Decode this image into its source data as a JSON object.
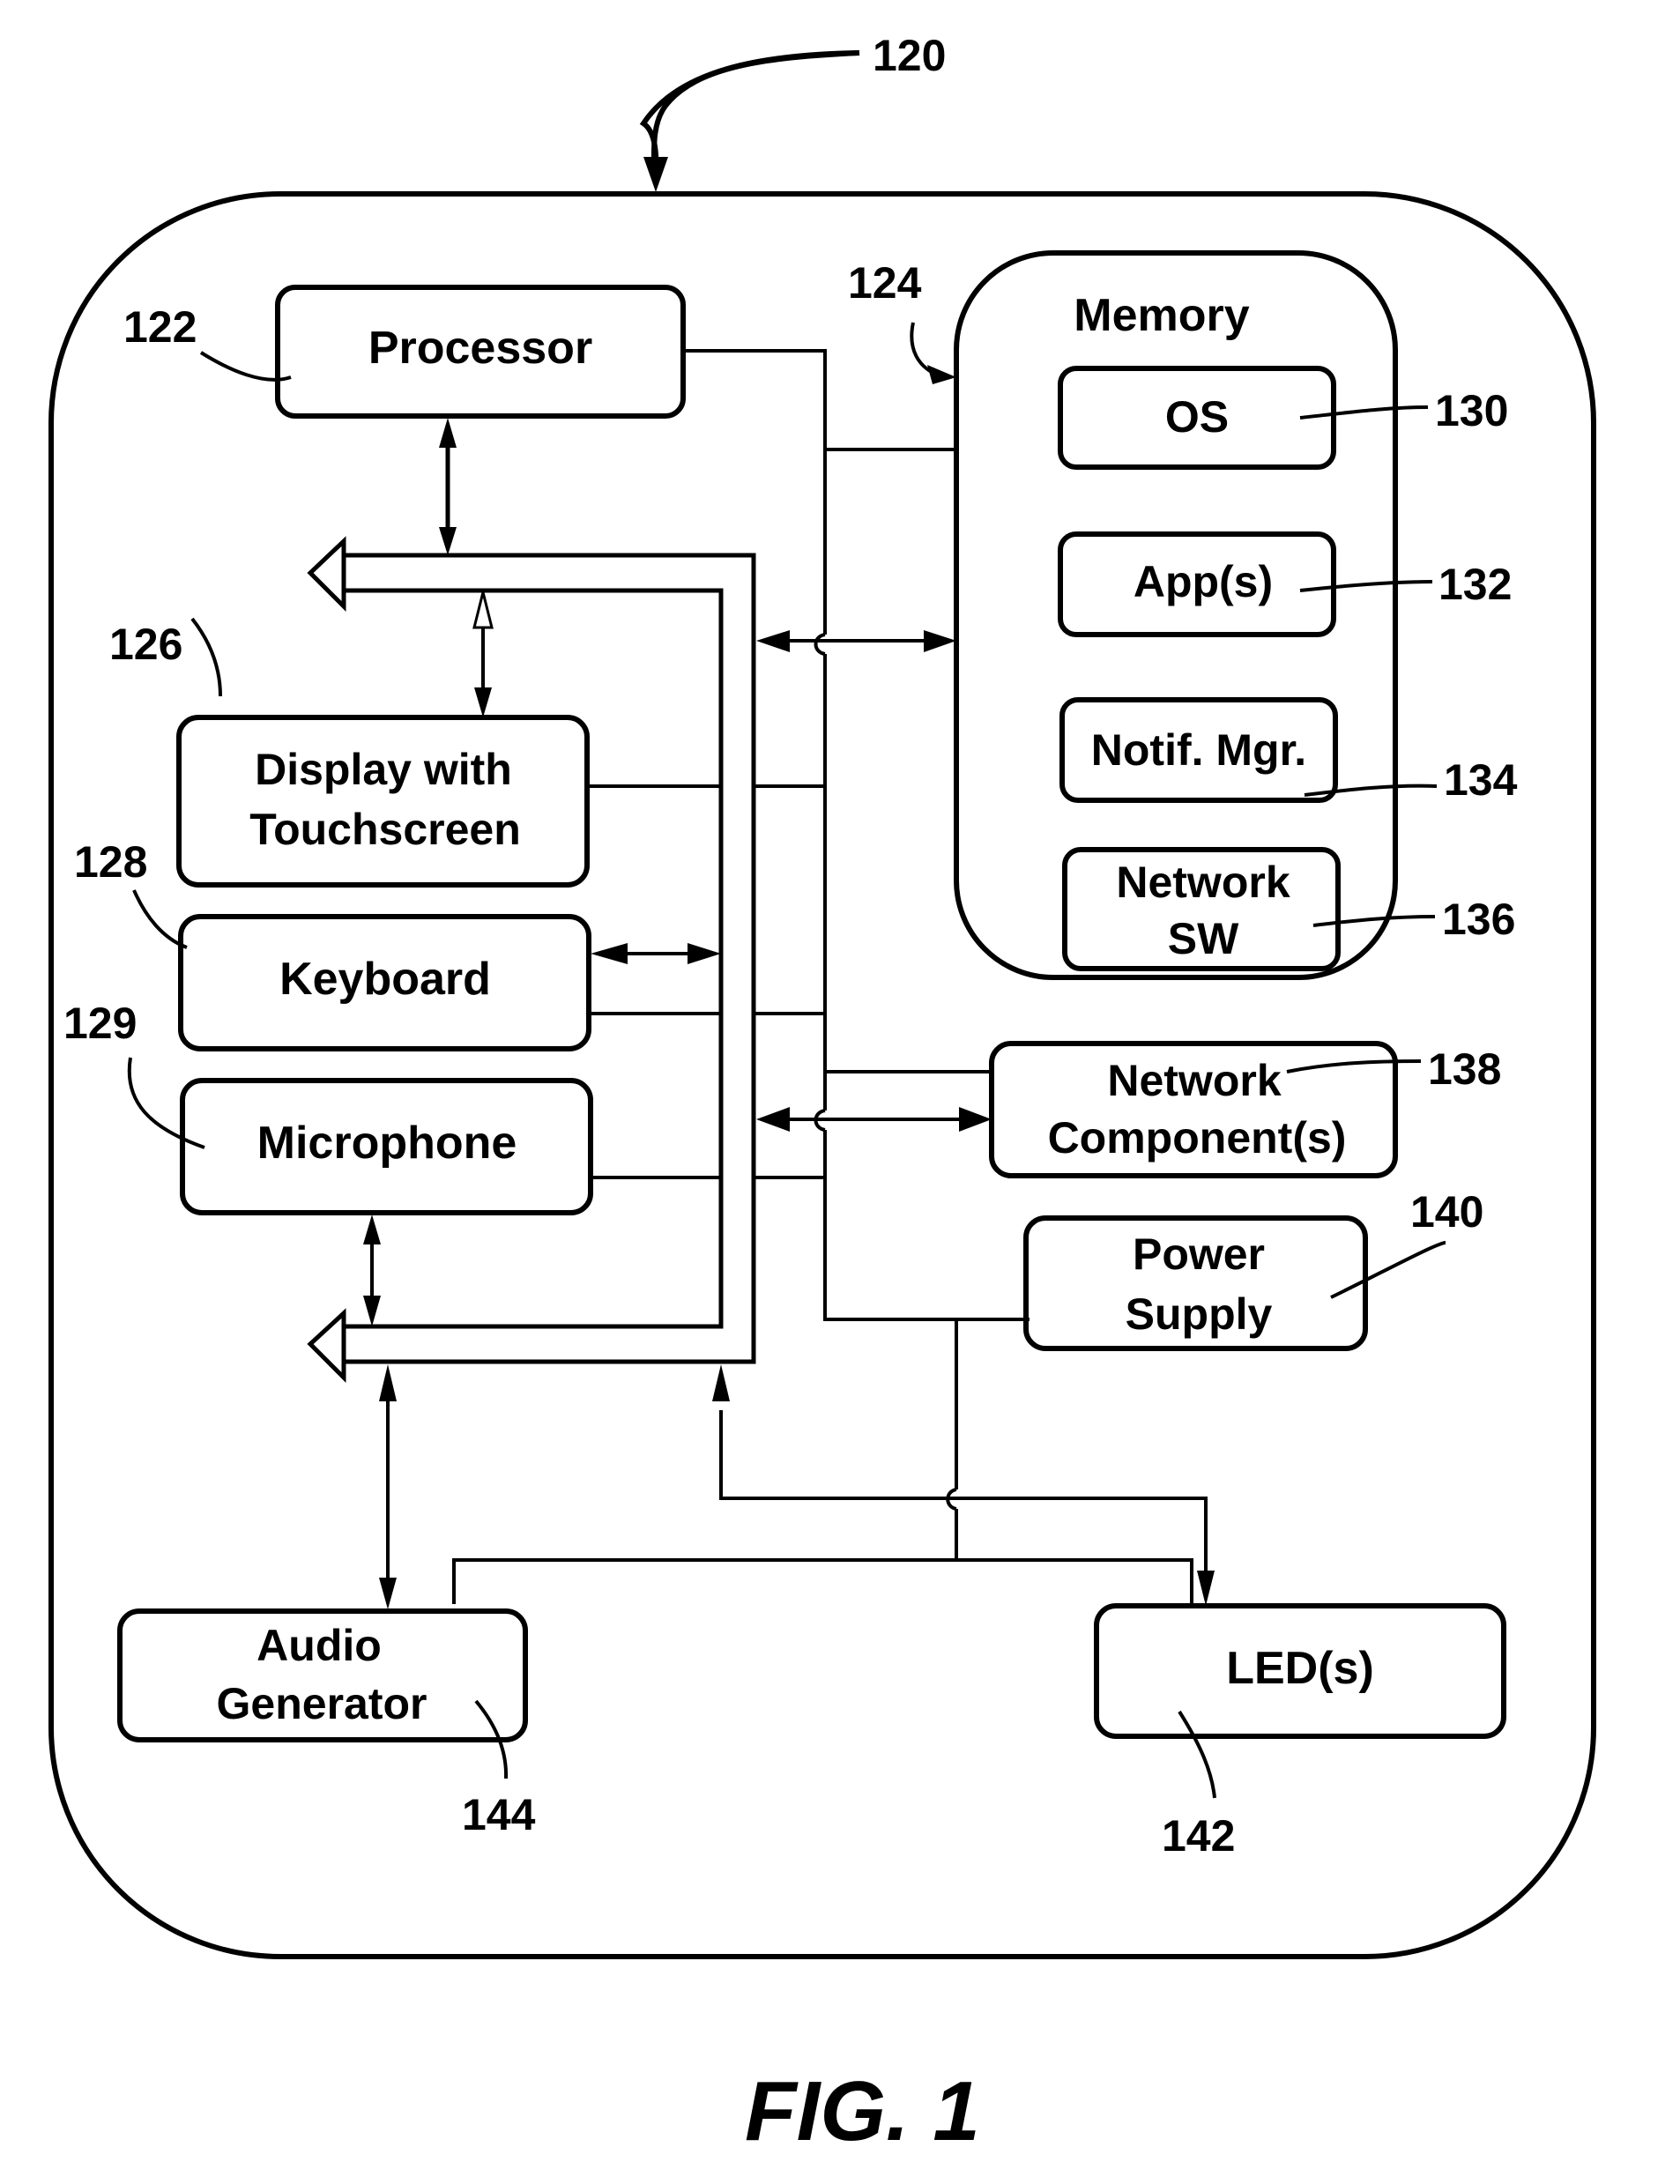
{
  "figure": {
    "caption": "FIG. 1",
    "device_ref": "120"
  },
  "blocks": {
    "processor": {
      "label": "Processor",
      "ref": "122"
    },
    "memory": {
      "label": "Memory",
      "ref": "124"
    },
    "display": {
      "label_line1": "Display with",
      "label_line2": "Touchscreen",
      "ref": "126"
    },
    "keyboard": {
      "label": "Keyboard",
      "ref": "128"
    },
    "microphone": {
      "label": "Microphone",
      "ref": "129"
    },
    "os": {
      "label": "OS",
      "ref": "130"
    },
    "apps": {
      "label": "App(s)",
      "ref": "132"
    },
    "notif_mgr": {
      "label": "Notif. Mgr.",
      "ref": "134"
    },
    "network_sw": {
      "label_line1": "Network",
      "label_line2": "SW",
      "ref": "136"
    },
    "network_components": {
      "label_line1": "Network",
      "label_line2": "Component(s)",
      "ref": "138"
    },
    "power_supply": {
      "label_line1": "Power",
      "label_line2": "Supply",
      "ref": "140"
    },
    "leds": {
      "label": "LED(s)",
      "ref": "142"
    },
    "audio_generator": {
      "label_line1": "Audio",
      "label_line2": "Generator",
      "ref": "144"
    }
  }
}
